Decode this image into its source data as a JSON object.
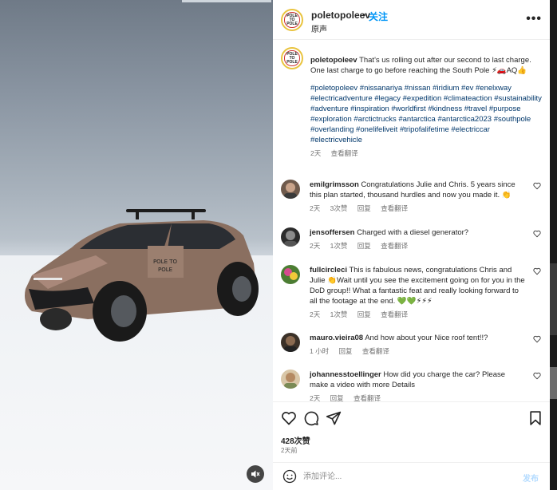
{
  "post": {
    "username": "poletopoleev",
    "follow_label": "关注",
    "dot": "•",
    "audio_label": "原声",
    "more_icon": "more-horizontal-icon"
  },
  "caption": {
    "username": "poletopoleev",
    "text": "That's us rolling out after our second to last charge. One last charge to go before reaching the South Pole ⚡🚗AQ👍",
    "hashtags": "#poletopoleev #nissanariya #nissan #iridium #ev #enelxway #electricadventure #legacy #expedition #climateaction #sustainability #adventure #inspiration #worldfirst #kindness #travel #purpose #exploration #arctictrucks #antarctica #antarctica2023 #southpole #overlanding #onelifeliveit #tripofalifetime #electriccar #electricvehicle",
    "time": "2天",
    "translate": "查看翻译"
  },
  "comments": [
    {
      "username": "emilgrimsson",
      "text": "Congratulations Julie and Chris. 5 years since this plan started, thousand hurdles and now you made it. 👏",
      "time": "2天",
      "likes": "3次赞",
      "reply": "回复",
      "translate": "查看翻译",
      "avatar_color": "#8a6b5a"
    },
    {
      "username": "jensoffersen",
      "text": "Charged with a diesel generator?",
      "time": "2天",
      "likes": "1次赞",
      "reply": "回复",
      "translate": "查看翻译",
      "avatar_color": "#2d2d2d"
    },
    {
      "username": "fullcircleci",
      "text": "This is fabulous news, congratulations Chris and Julie 👏Wait until you see the excitement going on for you in the DoD group!! What a fantastic feat and really looking forward to all the footage at the end. 💚💚⚡⚡⚡",
      "time": "2天",
      "likes": "1次赞",
      "reply": "回复",
      "translate": "查看翻译",
      "avatar_color": "#5b8f3a"
    },
    {
      "username": "mauro.vieira08",
      "text": "And how about your Nice roof tent!!?",
      "time": "1 小时",
      "likes": "",
      "reply": "回复",
      "translate": "查看翻译",
      "avatar_color": "#3b3128"
    },
    {
      "username": "johannesstoellinger",
      "text": "How did you charge the car? Please make a video with more Details",
      "time": "2天",
      "likes": "",
      "reply": "回复",
      "translate": "查看翻译",
      "avatar_color": "#c9b08a"
    }
  ],
  "actions": {
    "like_icon": "heart-icon",
    "comment_icon": "comment-icon",
    "share_icon": "send-icon",
    "save_icon": "bookmark-icon",
    "likes_count": "428次赞",
    "posted": "2天前"
  },
  "composer": {
    "placeholder": "添加评论...",
    "post_label": "发布",
    "emoji_icon": "emoji-icon"
  },
  "media": {
    "mute_icon": "volume-muted-icon"
  },
  "colors": {
    "link": "#0095f6",
    "hashtag": "#00376b",
    "muted": "#737373"
  }
}
